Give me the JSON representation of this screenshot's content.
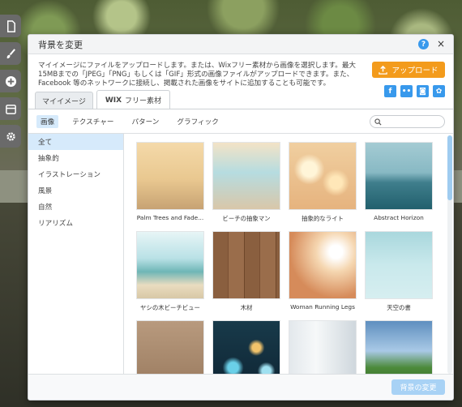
{
  "dialog": {
    "title": "背景を変更",
    "help_label": "?",
    "close_label": "×",
    "description": "マイイメージにファイルをアップロードします。または、Wixフリー素材から画像を選択します。最大15MBまでの「JPEG」「PNG」もしくは「GIF」形式の画像ファイルがアップロードできます。また、Facebook 等のネットワークに接続し、掲載された画像をサイトに追加することも可能です。",
    "upload_label": "アップロード",
    "apply_label": "背景の変更"
  },
  "social": [
    {
      "name": "facebook-icon",
      "glyph": "f"
    },
    {
      "name": "flickr-icon",
      "glyph": "••"
    },
    {
      "name": "instagram-icon",
      "glyph": "◙"
    },
    {
      "name": "picasa-icon",
      "glyph": "✿"
    }
  ],
  "tabs": {
    "my_images": "マイイメージ",
    "wix_brand": "WIX",
    "wix_free": "フリー素材"
  },
  "filters": [
    "画像",
    "テクスチャー",
    "パターン",
    "グラフィック"
  ],
  "active_filter": "画像",
  "categories": [
    "全て",
    "抽象的",
    "イラストレーション",
    "風景",
    "自然",
    "リアリズム"
  ],
  "active_category": "全て",
  "images": [
    {
      "caption": "Palm Trees and Fade...",
      "style": "img-palm"
    },
    {
      "caption": "ビーチの抽象マン",
      "style": "img-beach"
    },
    {
      "caption": "抽象的なライト",
      "style": "img-bokeh"
    },
    {
      "caption": "Abstract Horizon",
      "style": "img-horizon"
    },
    {
      "caption": "ヤシの木ビーチビュー",
      "style": "img-palmbeach"
    },
    {
      "caption": "木材",
      "style": "img-wood"
    },
    {
      "caption": "Woman Running Legs",
      "style": "img-runner"
    },
    {
      "caption": "天空の書",
      "style": "img-sky"
    },
    {
      "caption": "",
      "style": "img-food"
    },
    {
      "caption": "",
      "style": "img-bokeh2"
    },
    {
      "caption": "",
      "style": "img-office"
    },
    {
      "caption": "",
      "style": "img-soccer"
    }
  ],
  "colors": {
    "accent_blue": "#3899ec",
    "upload_orange": "#f39b1c",
    "selected_bg": "#d6eafb",
    "apply_disabled": "#a8d2f5"
  }
}
